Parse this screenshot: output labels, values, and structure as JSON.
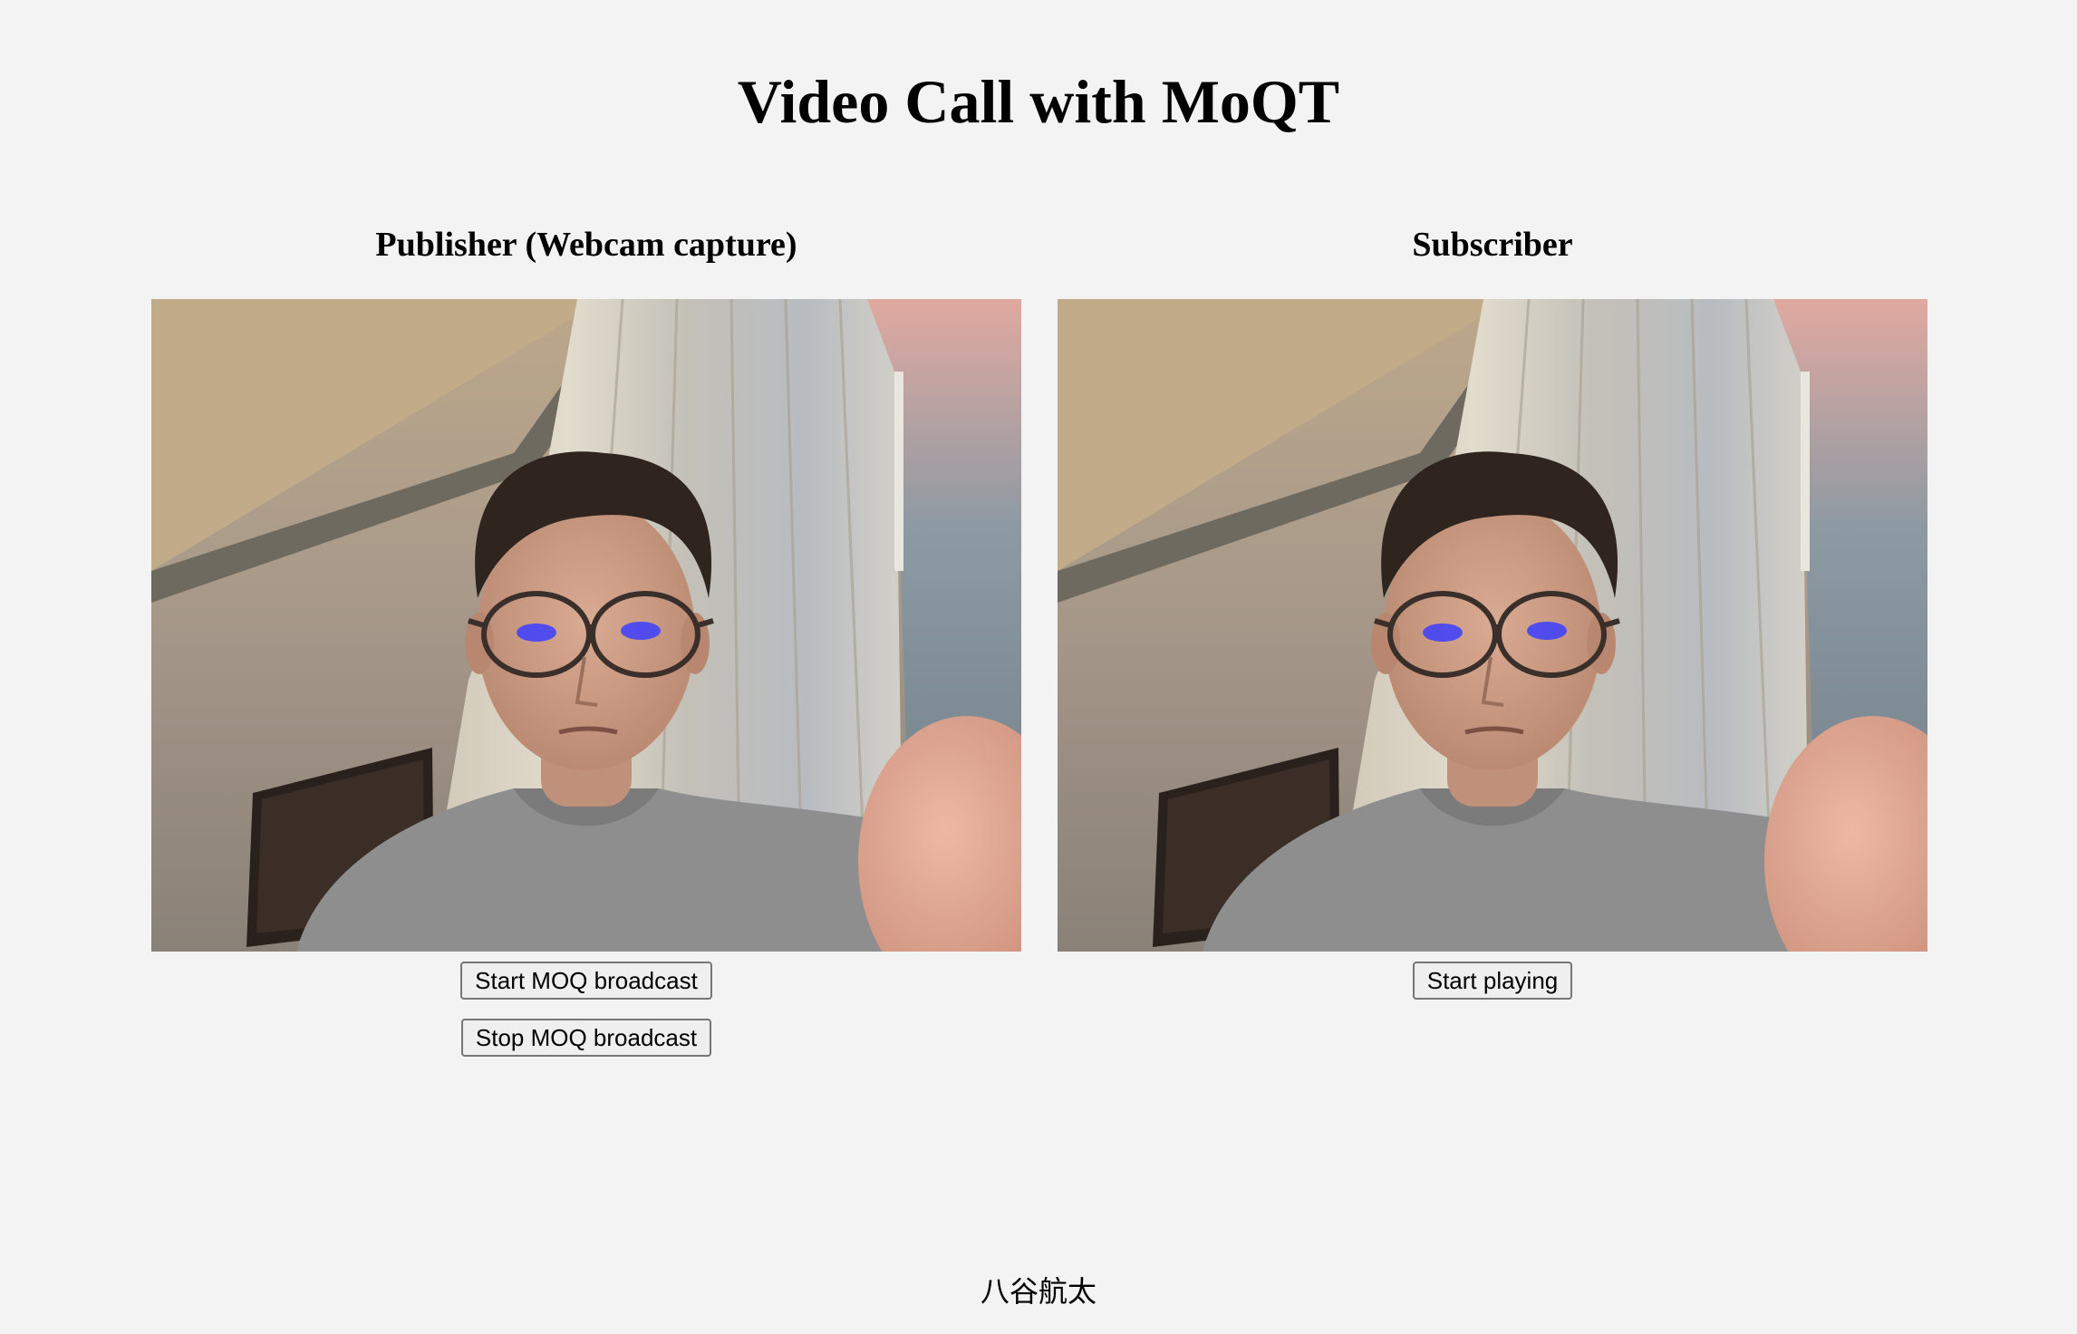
{
  "page": {
    "title": "Video Call with MoQT",
    "footer": "八谷航太"
  },
  "publisher": {
    "heading": "Publisher (Webcam capture)",
    "start_label": "Start MOQ broadcast",
    "stop_label": "Stop MOQ broadcast"
  },
  "subscriber": {
    "heading": "Subscriber",
    "play_label": "Start playing"
  },
  "colors": {
    "background": "#f3f3f3",
    "button_bg": "#efefef",
    "button_border": "#767676"
  }
}
